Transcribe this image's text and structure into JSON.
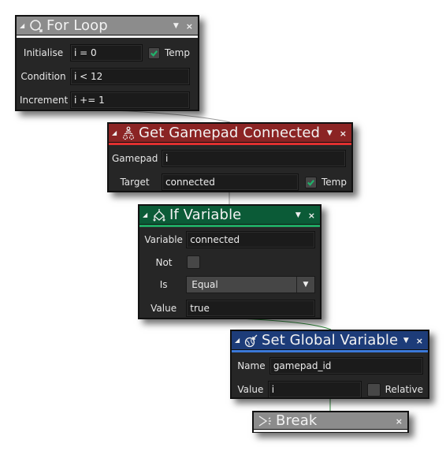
{
  "blocks": {
    "for_loop": {
      "title": "For Loop",
      "icon": "for-loop-icon",
      "header_color": "#8c8c8c",
      "stripe_color": "#f0f0f0",
      "fields": {
        "initialise": {
          "label": "Initialise",
          "value": "i = 0"
        },
        "condition": {
          "label": "Condition",
          "value": "i < 12"
        },
        "increment": {
          "label": "Increment",
          "value": "i += 1"
        }
      },
      "temp": {
        "label": "Temp",
        "checked": true
      }
    },
    "get_gamepad_connected": {
      "title": "Get Gamepad Connected",
      "icon": "gamepad-connected-icon",
      "header_color": "#8b2424",
      "stripe_color": "#e03030",
      "fields": {
        "gamepad": {
          "label": "Gamepad",
          "value": "i"
        },
        "target": {
          "label": "Target",
          "value": "connected"
        }
      },
      "temp": {
        "label": "Temp",
        "checked": true
      }
    },
    "if_variable": {
      "title": "If Variable",
      "icon": "branch-icon",
      "header_color": "#0b5b37",
      "stripe_color": "#1fa863",
      "fields": {
        "variable": {
          "label": "Variable",
          "value": "connected"
        },
        "not": {
          "label": "Not",
          "checked": false
        },
        "is": {
          "label": "Is",
          "value": "Equal"
        },
        "value": {
          "label": "Value",
          "value": "true"
        }
      }
    },
    "set_global_variable": {
      "title": "Set Global Variable",
      "icon": "globe-arrow-icon",
      "header_color": "#1d3c79",
      "stripe_color": "#3a78d8",
      "fields": {
        "name": {
          "label": "Name",
          "value": "gamepad_id"
        },
        "value": {
          "label": "Value",
          "value": "i"
        }
      },
      "relative": {
        "label": "Relative",
        "checked": false
      }
    },
    "break": {
      "title": "Break",
      "icon": "break-icon",
      "header_color": "#8c8c8c",
      "stripe_color": "#f0f0f0"
    }
  },
  "controls": {
    "collapse_glyph": "◢",
    "dropdown_glyph": "▼",
    "close_glyph": "×"
  },
  "wire_colors": {
    "neutral": "#9a9a9a",
    "branch": "#2f8a3a"
  }
}
